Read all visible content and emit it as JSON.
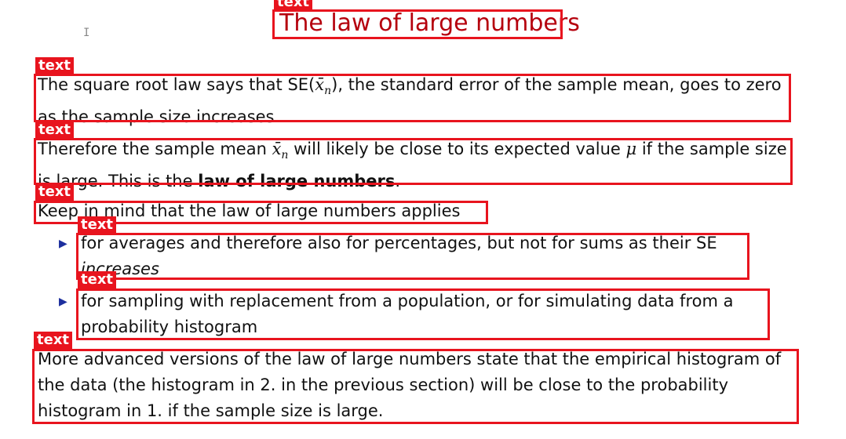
{
  "annotation_label": "text",
  "colors": {
    "annotation": "#e8141e",
    "title": "#b5000d",
    "bullet": "#1d2f9e",
    "text": "#111111"
  },
  "cursor_icon": "text-cursor-icon",
  "bullet_icon": "triangle-right-icon",
  "slide": {
    "title": "The law of large numbers",
    "p1": {
      "a": "The square root law says that SE(",
      "math": "x̄",
      "sub": "n",
      "b": "), the standard error of the sample mean, goes to zero as the sample size increases."
    },
    "p2": {
      "a": "Therefore the sample mean ",
      "math": "x̄",
      "sub": "n",
      "b": " will likely be close to its expected value ",
      "mu": "μ",
      "c": " if the sample size is large. This is the ",
      "bold": "law of large numbers",
      "d": "."
    },
    "p3": "Keep in mind that the law of large numbers applies",
    "bullet1": {
      "a": "for averages and therefore also for percentages, but not for sums as their SE ",
      "italic": "increases"
    },
    "bullet2": "for sampling with replacement from a population, or for simulating data from a probability histogram",
    "p4": "More advanced versions of the law of large numbers state that the empirical histogram of the data (the histogram in 2. in the previous section) will be close to the probability histogram in 1. if the sample size is large."
  }
}
